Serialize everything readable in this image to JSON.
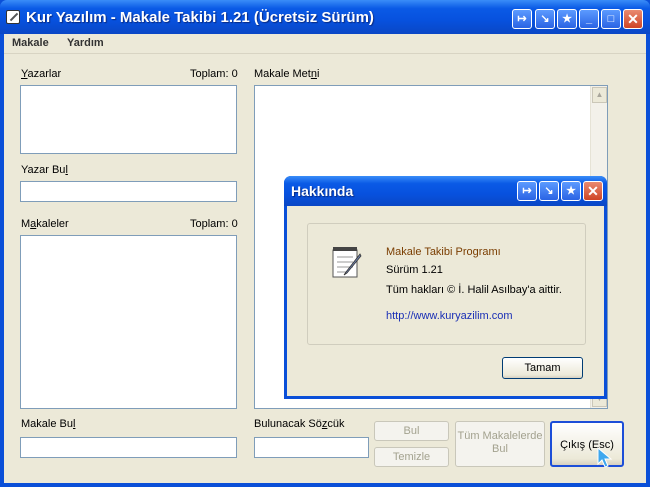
{
  "window": {
    "title": "Kur Yazılım - Makale Takibi 1.21 (Ücretsiz Sürüm)",
    "buttons": [
      "↦",
      "↘",
      "★",
      "_",
      "□",
      "✕"
    ]
  },
  "menu": {
    "items": [
      "Makale",
      "Yardım"
    ]
  },
  "authors": {
    "label_prefix": "",
    "label_ul": "Y",
    "label_rest": "azarlar",
    "count": "Toplam: 0"
  },
  "find_author": {
    "label_pre": "Yazar Bu",
    "label_ul": "l",
    "value": ""
  },
  "articles": {
    "label_pre": "M",
    "label_ul": "a",
    "label_rest": "kaleler",
    "count": "Toplam: 0"
  },
  "find_article": {
    "label_pre": "Makale Bu",
    "label_ul": "l",
    "value": ""
  },
  "article_text": {
    "label_pre": "Makale Met",
    "label_ul": "n",
    "label_rest": "i"
  },
  "search_word": {
    "label_pre": "Bulunacak Sö",
    "label_ul": "z",
    "label_rest": "cük",
    "value": ""
  },
  "buttons": {
    "find": "Bul",
    "clean": "Temizle",
    "find_all_line1": "Tüm Makalelerde",
    "find_all_line2": "Bul",
    "exit": "Çıkış (Esc)"
  },
  "about": {
    "title": "Hakkında",
    "buttons": [
      "↦",
      "↘",
      "★",
      "✕"
    ],
    "program": "Makale Takibi Programı",
    "version": "Sürüm 1.21",
    "rights": "Tüm hakları © İ. Halil Asılbay'a aittir.",
    "url": "http://www.kuryazilim.com",
    "ok": "Tamam"
  }
}
